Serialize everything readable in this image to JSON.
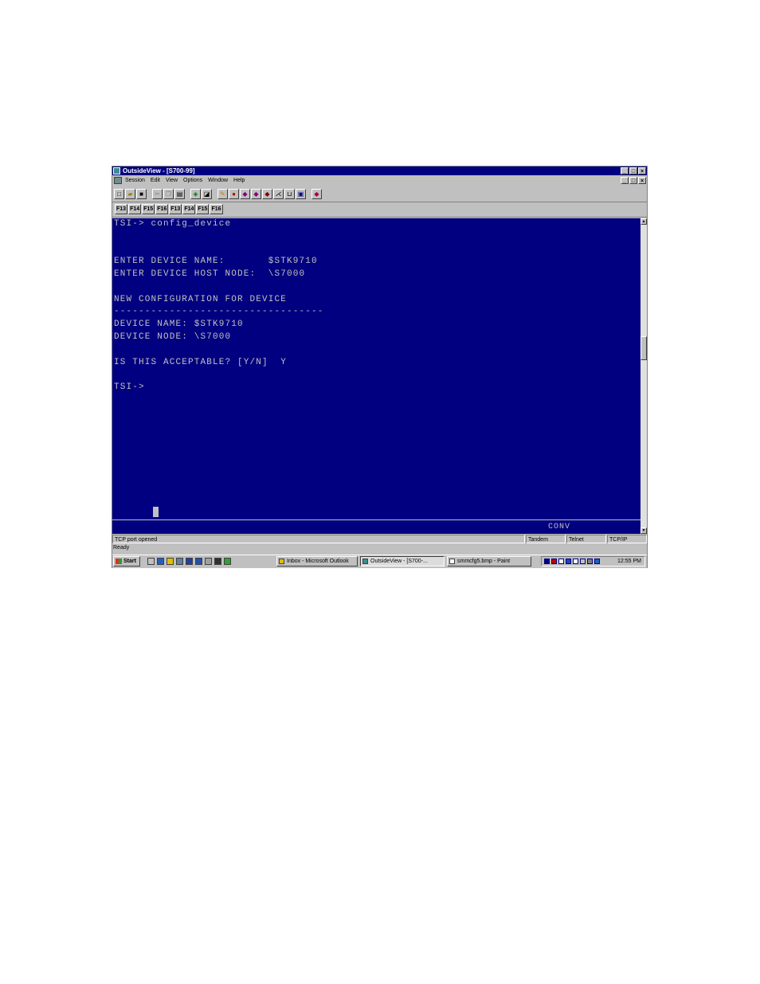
{
  "window": {
    "title": "OutsideView - [S700-99]"
  },
  "menu": [
    "Session",
    "Edit",
    "View",
    "Options",
    "Window",
    "Help"
  ],
  "function_keys": [
    "F13",
    "F14",
    "F15",
    "F16",
    "F13",
    "F14",
    "F15",
    "F16"
  ],
  "terminal": {
    "lines": [
      "TSI-> config_device",
      "",
      "",
      "ENTER DEVICE NAME:       $STK9710",
      "ENTER DEVICE HOST NODE:  \\S7000",
      "",
      "NEW CONFIGURATION FOR DEVICE",
      "----------------------------------",
      "DEVICE NAME: $STK9710",
      "DEVICE NODE: \\S7000",
      "",
      "IS THIS ACCEPTABLE? [Y/N]  Y",
      "",
      "TSI->"
    ],
    "mode": "CONV"
  },
  "statusbar": {
    "message": "TCP port opened",
    "host_type": "Tandem",
    "protocol": "Telnet",
    "transport": "TCP/IP"
  },
  "ready": "Ready",
  "taskbar": {
    "start": "Start",
    "tasks": [
      "Inbox - Microsoft Outlook",
      "OutsideView - [S700-...",
      "smmcfg5.bmp - Paint"
    ],
    "clock": "12:55 PM"
  }
}
